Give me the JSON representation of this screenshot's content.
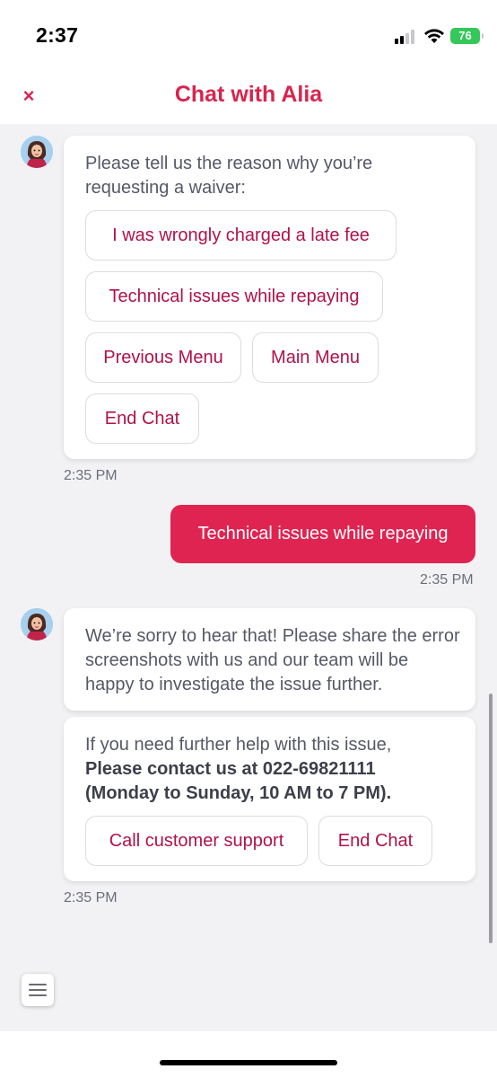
{
  "status_bar": {
    "time": "2:37",
    "battery": "76",
    "battery_color": "#34c759"
  },
  "header": {
    "close_icon": "close-icon",
    "close_glyph": "×",
    "title": "Chat with Alia",
    "accent_color": "#d9244f"
  },
  "messages": {
    "bot1": {
      "text": "Please tell us the reason why you’re requesting a waiver:",
      "options": [
        "I was wrongly charged a late fee",
        "Technical issues while repaying",
        "Previous Menu",
        "Main Menu",
        "End Chat"
      ],
      "time": "2:35 PM"
    },
    "user1": {
      "text": "Technical issues while repaying",
      "time": "2:35 PM",
      "bubble_color": "#e02452"
    },
    "bot2": {
      "text": "We’re sorry to hear that! Please share the error screenshots with us and our team will be happy to investigate the issue further."
    },
    "bot3": {
      "text_prefix": "If you need further help with this issue,",
      "text_bold": "Please contact us at 022-69821111 (Monday to Sunday, 10 AM to 7 PM).",
      "options": [
        "Call customer support",
        "End Chat"
      ],
      "time": "2:35 PM"
    }
  },
  "footer": {
    "menu_icon": "hamburger-menu-icon"
  }
}
